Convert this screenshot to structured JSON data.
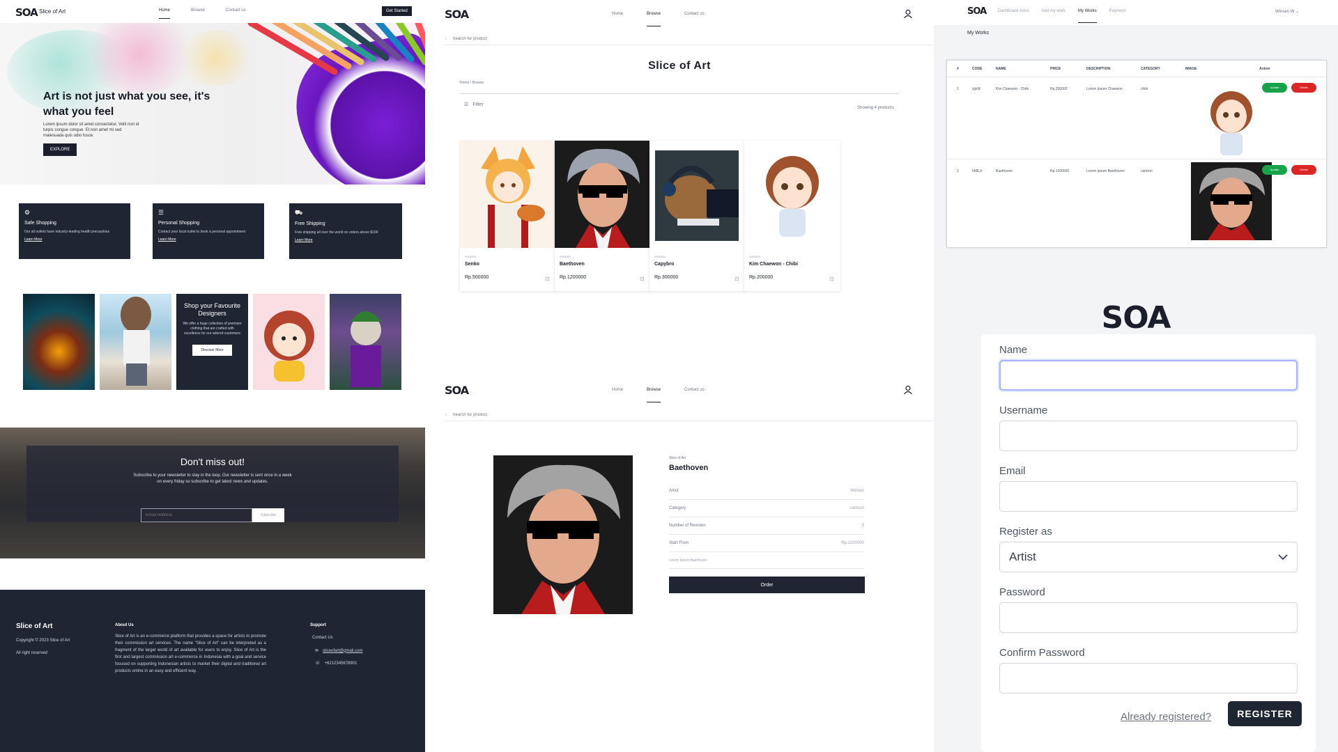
{
  "landing": {
    "brand": "SOA",
    "site_name": "Slice of Art",
    "nav": [
      "Home",
      "Browse",
      "Contact us"
    ],
    "cta": "Get Started",
    "hero": {
      "headline": "Art is not just what you see, it's what you feel",
      "body": "Lorem ipsum dolor sit amet consectetur. Velit non id turpis congue congue. Et non amet mi sed malesuada quis odio fusce.",
      "button": "EXPLORE"
    },
    "features": [
      {
        "icon": "shield-icon",
        "title": "Safe Shopping",
        "desc": "Our all outlets have industry-leading health precautions",
        "link": "Learn More"
      },
      {
        "icon": "store-icon",
        "title": "Personal Shopping",
        "desc": "Contact your local outlet to book a personal appointment",
        "link": "Learn More"
      },
      {
        "icon": "truck-icon",
        "title": "Free Shipping",
        "desc": "Free shipping all over the world on orders above $100",
        "link": "Learn More"
      }
    ],
    "promo": {
      "title": "Shop your Favourite Designers",
      "desc": "We offer a huge collection of premium clothing that are crafted with excellence for our adored customers",
      "button": "Discover More"
    },
    "newsletter": {
      "title": "Don't miss out!",
      "desc": "Subscribe to your newsletter to stay in the loop. Our newsletter is sent once in a week on every friday so subscribe to get latest news and updates.",
      "placeholder": "Email Address",
      "button": "Subscribe"
    },
    "footer": {
      "brand": "Slice of Art",
      "copyright": "Copyright © 2023 Slice of Art",
      "rights": "All right reserved",
      "about_title": "About Us",
      "about_text": "Slice of Art is an e-commerce platform that provides a space for artists to promote their commission art services. The name \"Slice of Art\" can be interpreted as a fragment of the larger world of art available for users to enjoy. Slice of Art is the first and largest commission art e-commerce in Indonesia with a goal and service focused on supporting Indonesian artists to market their digital and traditional art products online in an easy and efficient way.",
      "support_title": "Support",
      "contact": "Contact Us",
      "email": "sliceofart@gmail.com",
      "phone": "+6212345678901"
    }
  },
  "browse": {
    "brand": "SOA",
    "nav": [
      "Home",
      "Browse",
      "Contact us"
    ],
    "search_placeholder": "Search for product",
    "title": "Slice of Art",
    "breadcrumb": "Home / Browse",
    "filter": "Filter",
    "count": "Showing 4 products",
    "products": [
      {
        "artist": "WINSEN",
        "name": "Senko",
        "price": "Rp.500000"
      },
      {
        "artist": "WINSEN",
        "name": "Baethoven",
        "price": "Rp.1200000"
      },
      {
        "artist": "WINSEN",
        "name": "Capybro",
        "price": "Rp.300000"
      },
      {
        "artist": "WINSEN",
        "name": "Kim Chaewon - Chibi",
        "price": "Rp.200000"
      }
    ]
  },
  "detail": {
    "brand": "SOA",
    "nav": [
      "Home",
      "Browse",
      "Contact us"
    ],
    "search_placeholder": "Search for product",
    "shop": "Slice of Art",
    "name": "Baethoven",
    "rows": [
      {
        "label": "Artist",
        "value": "Winsen"
      },
      {
        "label": "Category",
        "value": "cartoon"
      },
      {
        "label": "Number of Revision",
        "value": "3"
      },
      {
        "label": "Start From",
        "value": "Rp.1200000"
      }
    ],
    "description": "Lorem Ipsum Baethoven",
    "order": "Order"
  },
  "dashboard": {
    "brand": "SOA",
    "nav": [
      "Dashboard Artist",
      "Add my work",
      "My Works",
      "Payment"
    ],
    "user": "Winsen W",
    "subtitle": "My Works",
    "columns": [
      "#",
      "CODE",
      "NAME",
      "PRICE",
      "DESCRIPTION",
      "CATEGORY",
      "IMAGE",
      "Action"
    ],
    "rows": [
      {
        "no": "1",
        "code": "zjjvW",
        "name": "Kim Chaewon - Chibi",
        "price": "Rp.200000",
        "desc": "Lorem Ipsum Chaewon",
        "category": "chibi"
      },
      {
        "no": "2",
        "code": "hMEJr",
        "name": "Baethoven",
        "price": "Rp.1200000",
        "desc": "Lorem Ipsum Baethoven",
        "category": "cartoon"
      }
    ],
    "update": "Update",
    "delete": "Delete"
  },
  "register": {
    "brand": "SOA",
    "fields": [
      "Name",
      "Username",
      "Email",
      "Register as",
      "Password",
      "Confirm Password"
    ],
    "register_as_value": "Artist",
    "link": "Already registered?",
    "button": "REGISTER"
  }
}
